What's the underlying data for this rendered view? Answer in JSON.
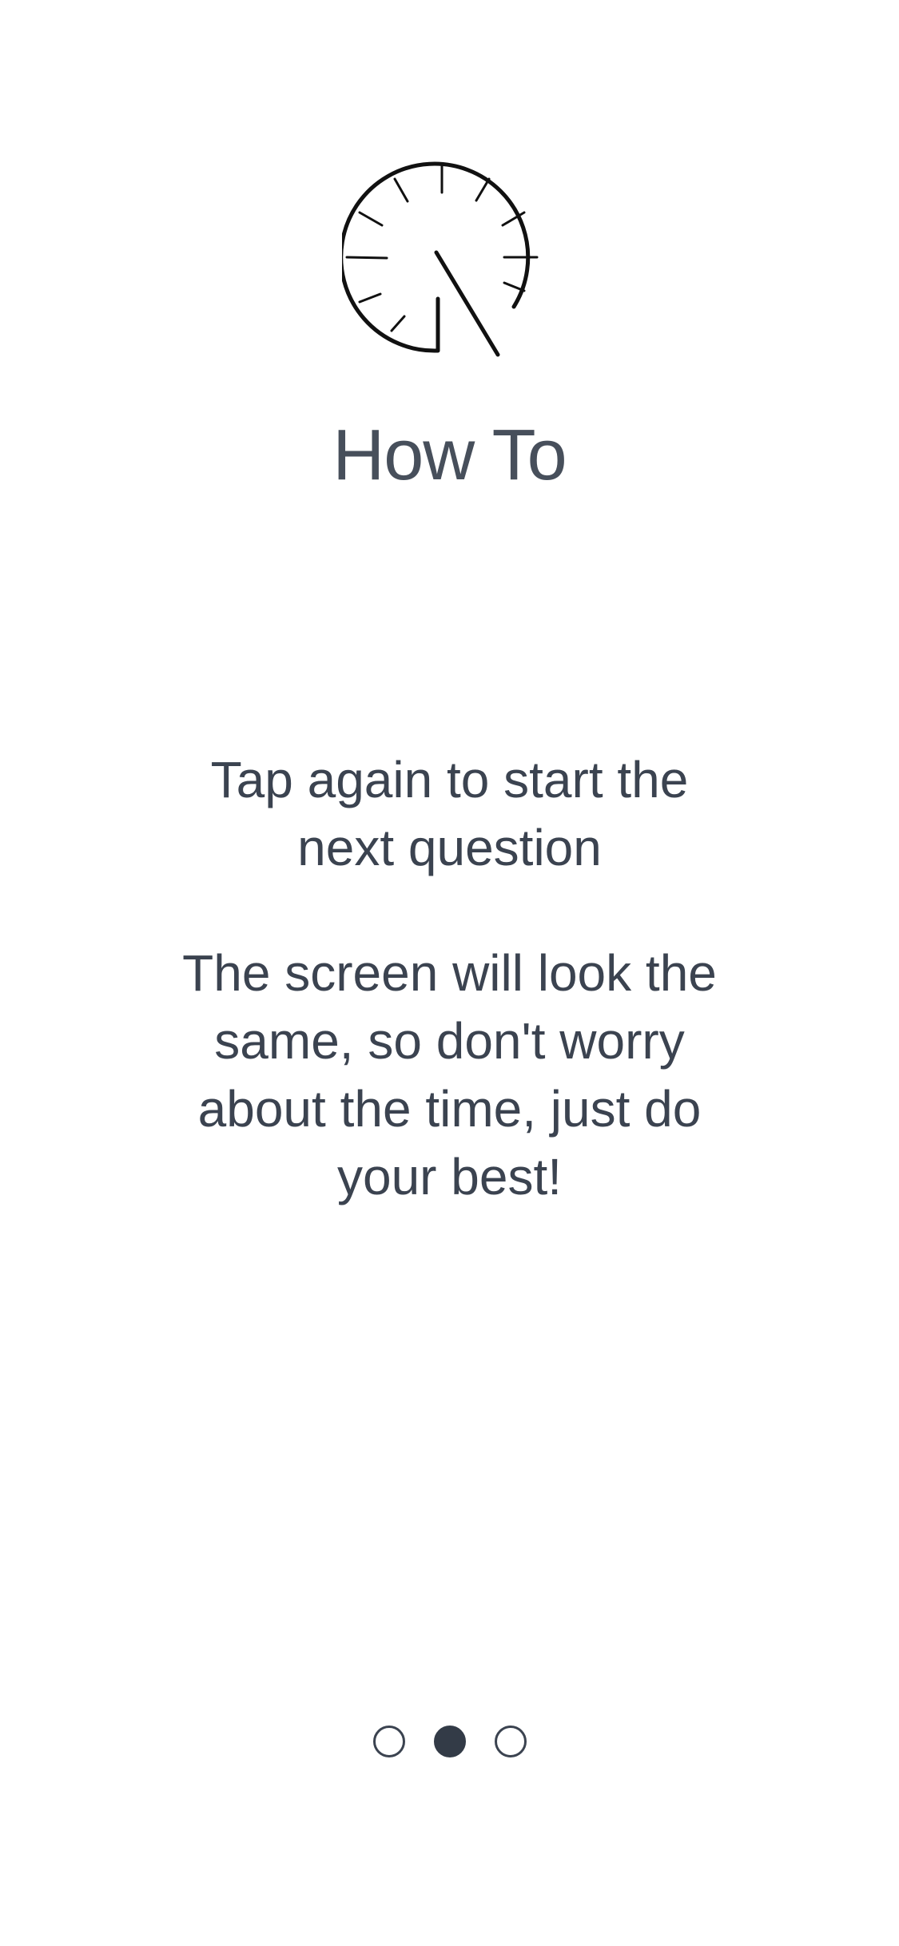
{
  "screen": {
    "title": "How To",
    "paragraphs": [
      "Tap again to start the next question",
      "The screen will look the same, so don't worry about the time, just do your best!"
    ],
    "logo_icon": "stopwatch-icon"
  },
  "pager": {
    "total": 3,
    "active_index": 1
  },
  "colors": {
    "text": "#3b4350",
    "active_dot": "#333b47",
    "background": "#ffffff"
  }
}
